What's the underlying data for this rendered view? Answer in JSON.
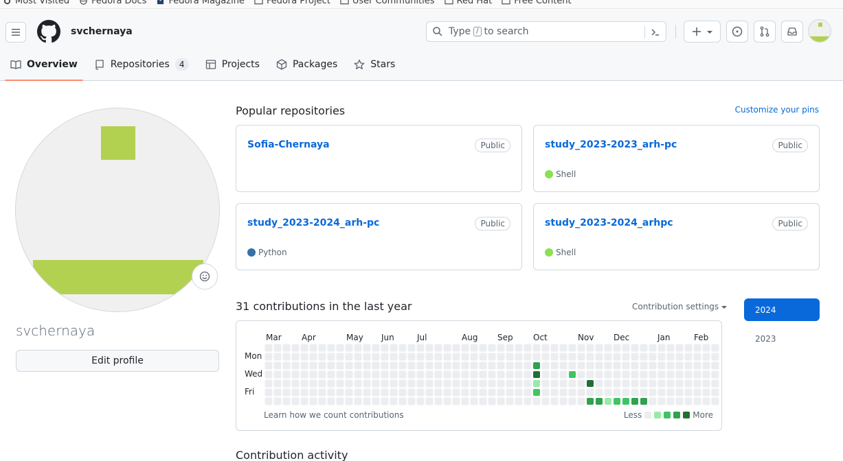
{
  "bookmarks": [
    {
      "label": "Most Visited",
      "icon": "gear-icon"
    },
    {
      "label": "Fedora Docs",
      "icon": "globe-icon"
    },
    {
      "label": "Fedora Magazine",
      "icon": "fedora-icon"
    },
    {
      "label": "Fedora Project",
      "icon": "folder-icon"
    },
    {
      "label": "User Communities",
      "icon": "folder-icon"
    },
    {
      "label": "Red Hat",
      "icon": "folder-icon"
    },
    {
      "label": "Free Content",
      "icon": "folder-icon"
    }
  ],
  "header": {
    "username": "svchernaya",
    "search_before": "Type",
    "search_key": "/",
    "search_after": "to search",
    "plus_label": "+"
  },
  "tabs": [
    {
      "label": "Overview",
      "icon": "book-icon",
      "active": true
    },
    {
      "label": "Repositories",
      "icon": "repo-icon",
      "count": "4"
    },
    {
      "label": "Projects",
      "icon": "table-icon"
    },
    {
      "label": "Packages",
      "icon": "package-icon"
    },
    {
      "label": "Stars",
      "icon": "star-icon"
    }
  ],
  "profile": {
    "name": "svchernaya",
    "edit_label": "Edit profile"
  },
  "popular": {
    "title": "Popular repositories",
    "customize": "Customize your pins",
    "repos": [
      {
        "name": "Sofia-Chernaya",
        "visibility": "Public",
        "language": "",
        "lang_color": ""
      },
      {
        "name": "study_2023-2023_arh-pc",
        "visibility": "Public",
        "language": "Shell",
        "lang_color": "#89e051"
      },
      {
        "name": "study_2023-2024_arh-pc",
        "visibility": "Public",
        "language": "Python",
        "lang_color": "#3572A5"
      },
      {
        "name": "study_2023-2024_arhpc",
        "visibility": "Public",
        "language": "Shell",
        "lang_color": "#89e051"
      }
    ]
  },
  "contributions": {
    "title": "31 contributions in the last year",
    "settings": "Contribution settings",
    "months": [
      "Mar",
      "Apr",
      "May",
      "Jun",
      "Jul",
      "Aug",
      "Sep",
      "Oct",
      "Nov",
      "Dec",
      "Jan",
      "Feb"
    ],
    "days": [
      "Mon",
      "Wed",
      "Fri"
    ],
    "learn": "Learn how we count contributions",
    "less": "Less",
    "more": "More",
    "level_colors": [
      "#ebedf0",
      "#9be9a8",
      "#40c463",
      "#30a14e",
      "#216e39"
    ],
    "active_cells": [
      {
        "week": 30,
        "day": 2,
        "level": 3
      },
      {
        "week": 30,
        "day": 3,
        "level": 4
      },
      {
        "week": 30,
        "day": 4,
        "level": 1
      },
      {
        "week": 30,
        "day": 5,
        "level": 2
      },
      {
        "week": 34,
        "day": 3,
        "level": 2
      },
      {
        "week": 36,
        "day": 4,
        "level": 4
      },
      {
        "week": 36,
        "day": 6,
        "level": 3
      },
      {
        "week": 37,
        "day": 6,
        "level": 3
      },
      {
        "week": 38,
        "day": 6,
        "level": 1
      },
      {
        "week": 39,
        "day": 6,
        "level": 2
      },
      {
        "week": 40,
        "day": 6,
        "level": 2
      },
      {
        "week": 41,
        "day": 6,
        "level": 3
      },
      {
        "week": 42,
        "day": 6,
        "level": 3
      }
    ]
  },
  "years": [
    {
      "label": "2024",
      "active": true
    },
    {
      "label": "2023",
      "active": false
    }
  ],
  "activity_title": "Contribution activity",
  "colors": {
    "accent": "#0969da",
    "tab_underline": "#fd8c73",
    "avatar_green": "#b3d151"
  }
}
